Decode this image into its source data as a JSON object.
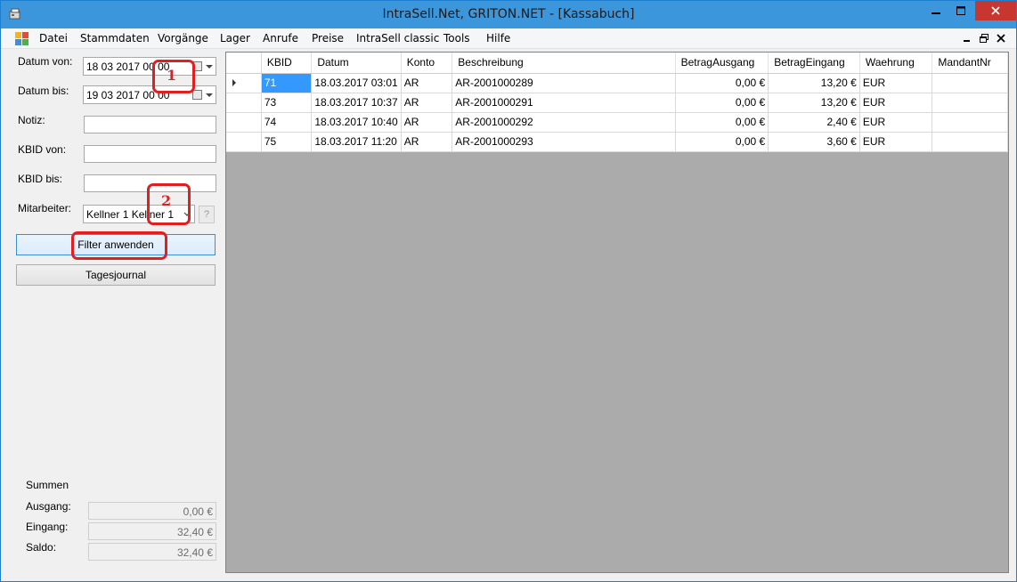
{
  "window": {
    "title": "IntraSell.Net, GRITON.NET - [Kassabuch]"
  },
  "menu": {
    "items": [
      "Datei",
      "Stammdaten",
      "Vorgänge",
      "Lager",
      "Anrufe",
      "Preise",
      "IntraSell classic",
      "Tools",
      "Hilfe"
    ]
  },
  "filters": {
    "datum_von_label": "Datum von:",
    "datum_von_value": "18 03 2017 00 00",
    "datum_bis_label": "Datum bis:",
    "datum_bis_value": "19 03 2017 00 00",
    "notiz_label": "Notiz:",
    "kbid_von_label": "KBID von:",
    "kbid_bis_label": "KBID bis:",
    "mitarbeiter_label": "Mitarbeiter:",
    "mitarbeiter_value": "Kellner 1 Kellner 1",
    "help_label": "?",
    "filter_button": "Filter anwenden",
    "tagesjournal_button": "Tagesjournal"
  },
  "annotations": {
    "one": "1",
    "two": "2"
  },
  "summen": {
    "title": "Summen",
    "ausgang_label": "Ausgang:",
    "ausgang_value": "0,00 €",
    "eingang_label": "Eingang:",
    "eingang_value": "32,40 €",
    "saldo_label": "Saldo:",
    "saldo_value": "32,40 €"
  },
  "grid": {
    "columns": [
      "KBID",
      "Datum",
      "Konto",
      "Beschreibung",
      "BetragAusgang",
      "BetragEingang",
      "Waehrung",
      "MandantNr"
    ],
    "rows": [
      [
        "71",
        "18.03.2017 03:01",
        "AR",
        "AR-2001000289",
        "0,00 €",
        "13,20 €",
        "EUR",
        ""
      ],
      [
        "73",
        "18.03.2017 10:37",
        "AR",
        "AR-2001000291",
        "0,00 €",
        "13,20 €",
        "EUR",
        ""
      ],
      [
        "74",
        "18.03.2017 10:40",
        "AR",
        "AR-2001000292",
        "0,00 €",
        "2,40 €",
        "EUR",
        ""
      ],
      [
        "75",
        "18.03.2017 11:20",
        "AR",
        "AR-2001000293",
        "0,00 €",
        "3,60 €",
        "EUR",
        ""
      ]
    ]
  },
  "colors": {
    "titlebar": "#3c96dc",
    "close_button": "#c7372f",
    "selection": "#3399ff",
    "annotation": "#e02020",
    "grid_background": "#ababab"
  }
}
